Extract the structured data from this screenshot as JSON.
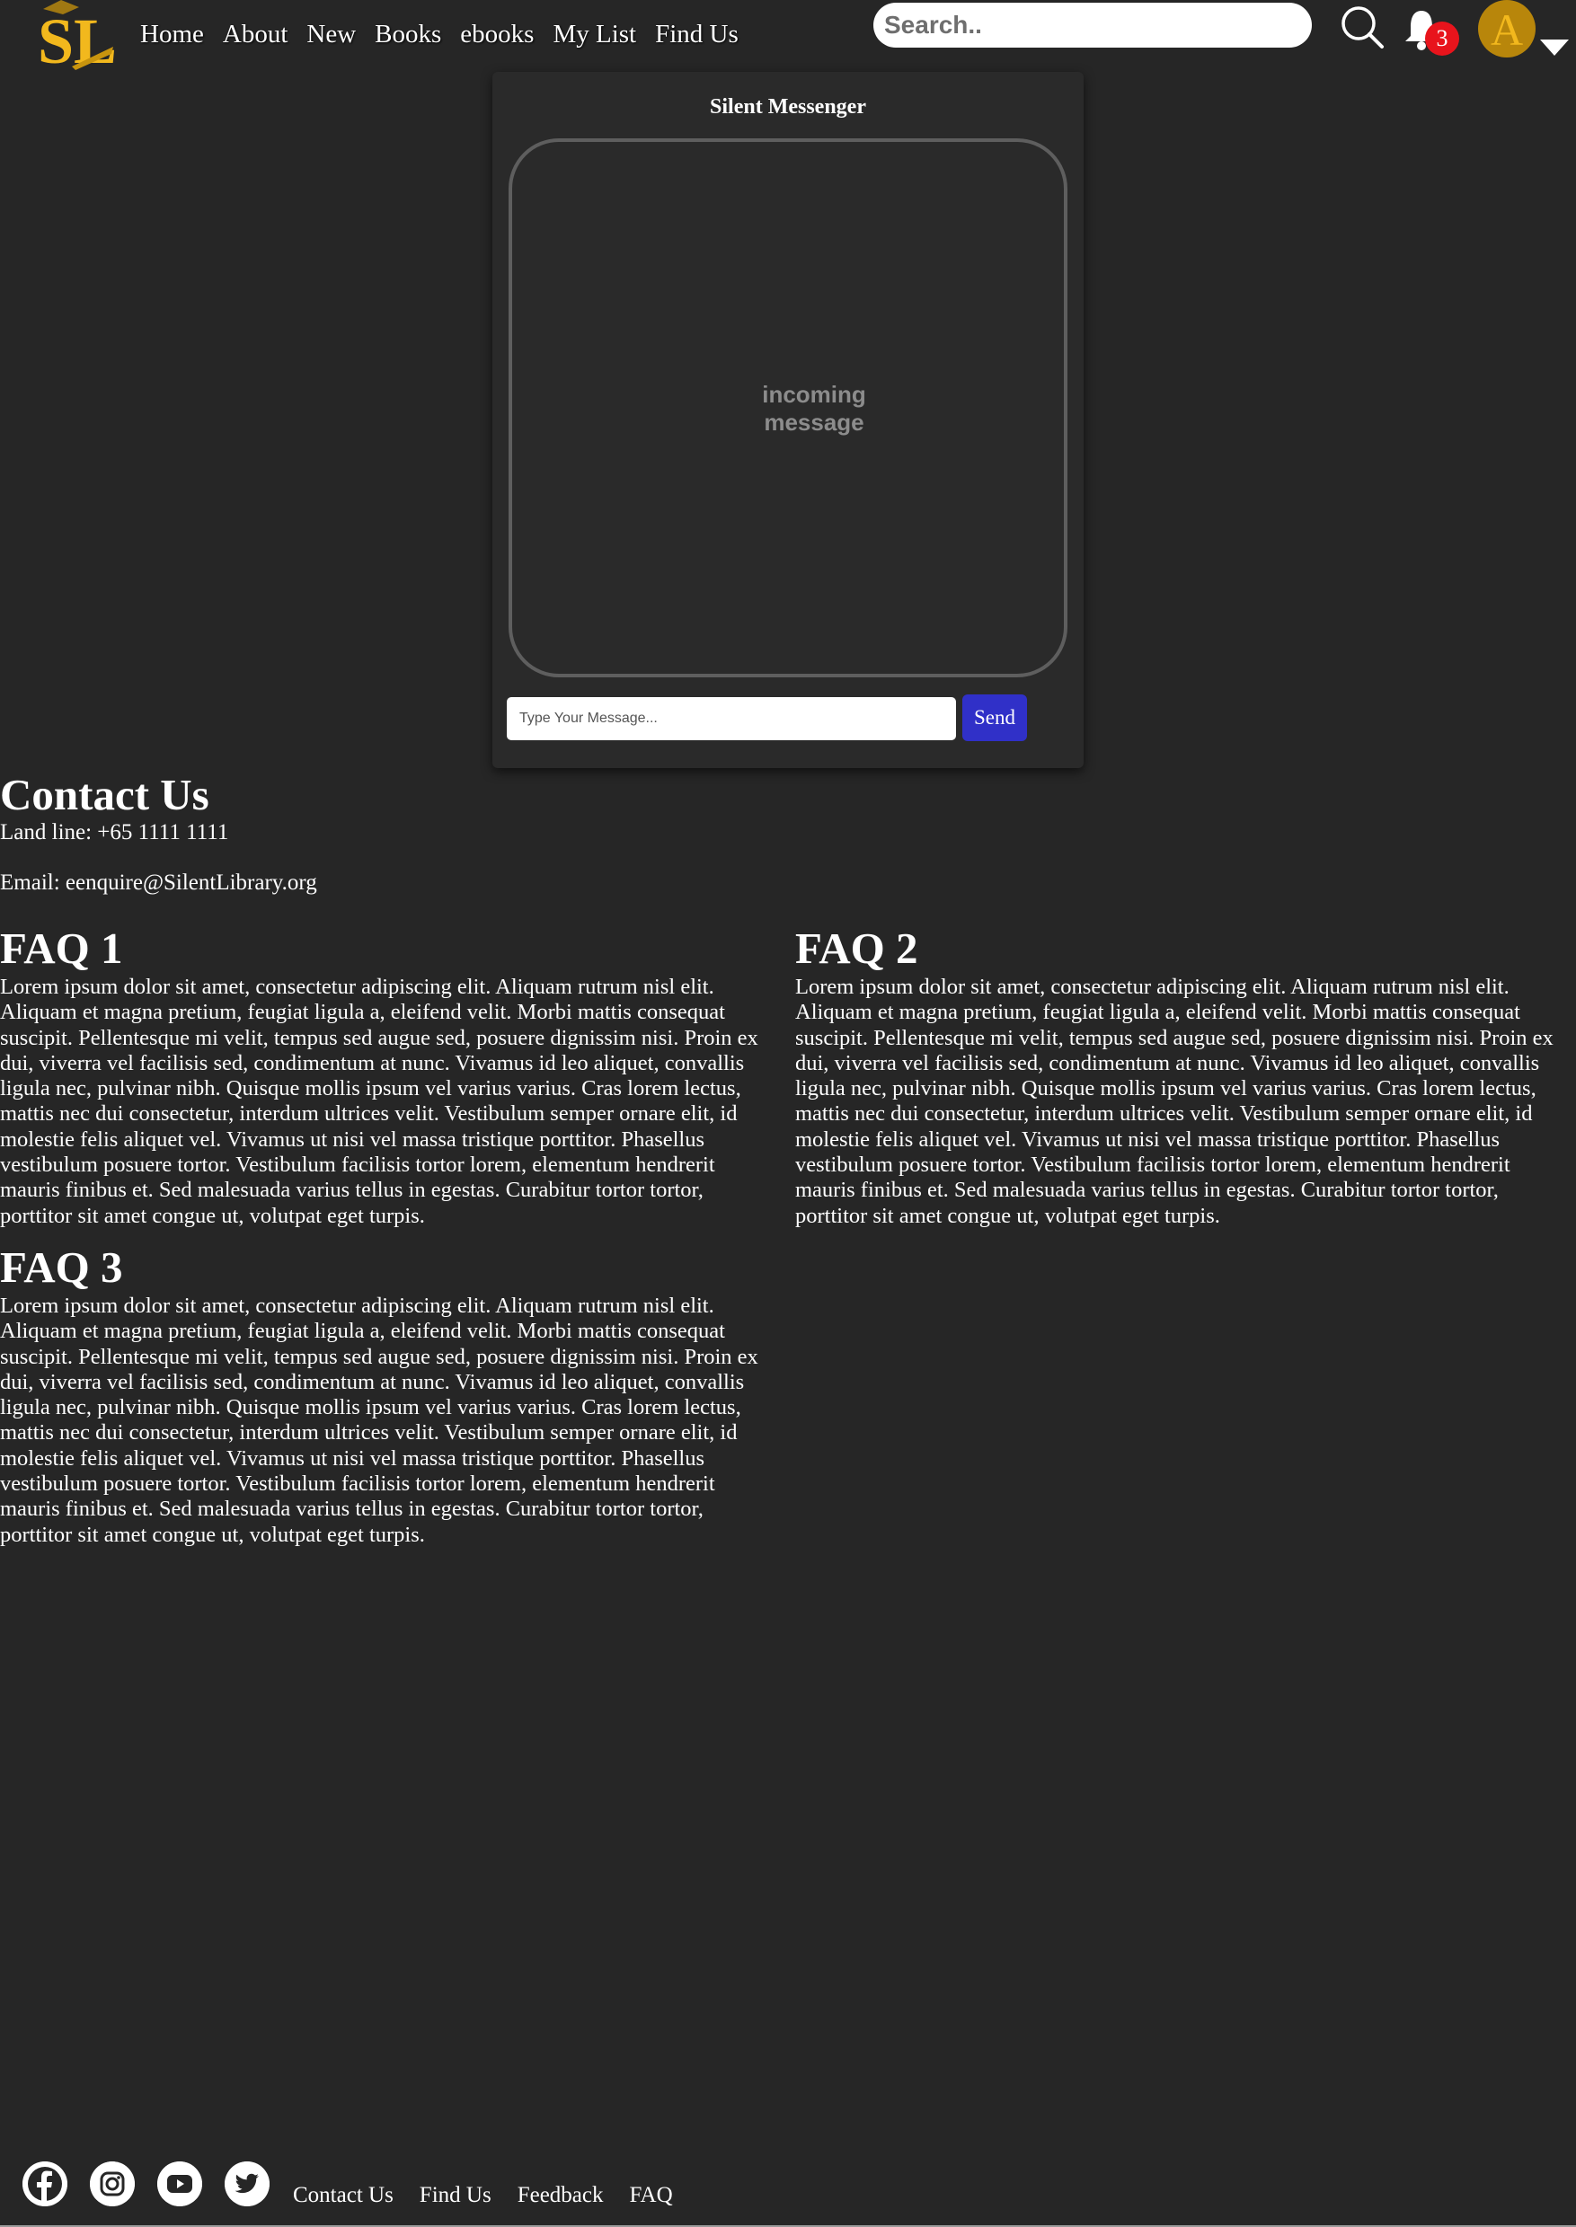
{
  "header": {
    "logo_text": "SL",
    "nav": [
      {
        "label": "Home"
      },
      {
        "label": "About"
      },
      {
        "label": "New"
      },
      {
        "label": "Books"
      },
      {
        "label": "ebooks"
      },
      {
        "label": "My List"
      },
      {
        "label": "Find Us"
      }
    ],
    "search_placeholder": "Search..",
    "notification_count": "3",
    "avatar_letter": "A"
  },
  "messenger": {
    "title": "Silent Messenger",
    "incoming_text": "incoming message",
    "input_placeholder": "Type Your Message...",
    "send_label": "Send"
  },
  "contact": {
    "title": "Contact Us",
    "landline": "Land line: +65 1111 1111",
    "email": "Email: eenquire@SilentLibrary.org"
  },
  "faqs": [
    {
      "title": "FAQ 1",
      "body": "Lorem ipsum dolor sit amet, consectetur adipiscing elit. Aliquam rutrum nisl elit. Aliquam et magna pretium, feugiat ligula a, eleifend velit. Morbi mattis consequat suscipit. Pellentesque mi velit, tempus sed augue sed, posuere dignissim nisi. Proin ex dui, viverra vel facilisis sed, condimentum at nunc. Vivamus id leo aliquet, convallis ligula nec, pulvinar nibh. Quisque mollis ipsum vel varius varius. Cras lorem lectus, mattis nec dui consectetur, interdum ultrices velit. Vestibulum semper ornare elit, id molestie felis aliquet vel. Vivamus ut nisi vel massa tristique porttitor. Phasellus vestibulum posuere tortor. Vestibulum facilisis tortor lorem, elementum hendrerit mauris finibus et. Sed malesuada varius tellus in egestas. Curabitur tortor tortor, porttitor sit amet congue ut, volutpat eget turpis."
    },
    {
      "title": "FAQ 2",
      "body": "Lorem ipsum dolor sit amet, consectetur adipiscing elit. Aliquam rutrum nisl elit. Aliquam et magna pretium, feugiat ligula a, eleifend velit. Morbi mattis consequat suscipit. Pellentesque mi velit, tempus sed augue sed, posuere dignissim nisi. Proin ex dui, viverra vel facilisis sed, condimentum at nunc. Vivamus id leo aliquet, convallis ligula nec, pulvinar nibh. Quisque mollis ipsum vel varius varius. Cras lorem lectus, mattis nec dui consectetur, interdum ultrices velit. Vestibulum semper ornare elit, id molestie felis aliquet vel. Vivamus ut nisi vel massa tristique porttitor. Phasellus vestibulum posuere tortor. Vestibulum facilisis tortor lorem, elementum hendrerit mauris finibus et. Sed malesuada varius tellus in egestas. Curabitur tortor tortor, porttitor sit amet congue ut, volutpat eget turpis."
    },
    {
      "title": "FAQ 3",
      "body": "Lorem ipsum dolor sit amet, consectetur adipiscing elit. Aliquam rutrum nisl elit. Aliquam et magna pretium, feugiat ligula a, eleifend velit. Morbi mattis consequat suscipit. Pellentesque mi velit, tempus sed augue sed, posuere dignissim nisi. Proin ex dui, viverra vel facilisis sed, condimentum at nunc. Vivamus id leo aliquet, convallis ligula nec, pulvinar nibh. Quisque mollis ipsum vel varius varius. Cras lorem lectus, mattis nec dui consectetur, interdum ultrices velit. Vestibulum semper ornare elit, id molestie felis aliquet vel. Vivamus ut nisi vel massa tristique porttitor. Phasellus vestibulum posuere tortor. Vestibulum facilisis tortor lorem, elementum hendrerit mauris finibus et. Sed malesuada varius tellus in egestas. Curabitur tortor tortor, porttitor sit amet congue ut, volutpat eget turpis."
    }
  ],
  "footer": {
    "social": [
      {
        "icon": "facebook-icon"
      },
      {
        "icon": "instagram-icon"
      },
      {
        "icon": "youtube-icon"
      },
      {
        "icon": "twitter-icon"
      }
    ],
    "links": [
      {
        "label": "Contact Us"
      },
      {
        "label": "Find Us"
      },
      {
        "label": "Feedback"
      },
      {
        "label": "FAQ"
      }
    ]
  },
  "colors": {
    "background": "#262626",
    "logo_gold": "#f2b81d",
    "send_button": "#3030c8",
    "badge": "#e8141c",
    "avatar": "#b8860b"
  }
}
